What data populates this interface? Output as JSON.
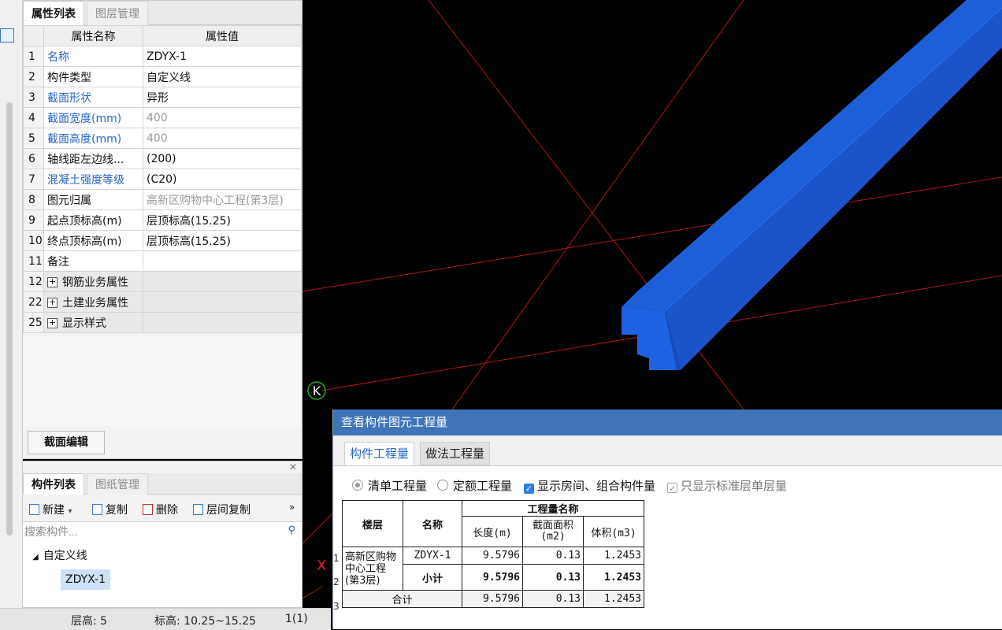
{
  "property_panel": {
    "tabs": [
      "属性列表",
      "图层管理"
    ],
    "headers": {
      "name": "属性名称",
      "value": "属性值"
    },
    "rows": [
      {
        "no": "1",
        "name": "名称",
        "value": "ZDYX-1",
        "name_color": "blue",
        "value_color": "normal"
      },
      {
        "no": "2",
        "name": "构件类型",
        "value": "自定义线",
        "name_color": "normal",
        "value_color": "normal"
      },
      {
        "no": "3",
        "name": "截面形状",
        "value": "异形",
        "name_color": "blue",
        "value_color": "normal"
      },
      {
        "no": "4",
        "name": "截面宽度(mm)",
        "value": "400",
        "name_color": "blue",
        "value_color": "grey"
      },
      {
        "no": "5",
        "name": "截面高度(mm)",
        "value": "400",
        "name_color": "blue",
        "value_color": "grey"
      },
      {
        "no": "6",
        "name": "轴线距左边线...",
        "value": "(200)",
        "name_color": "normal",
        "value_color": "normal"
      },
      {
        "no": "7",
        "name": "混凝土强度等级",
        "value": "(C20)",
        "name_color": "blue",
        "value_color": "normal"
      },
      {
        "no": "8",
        "name": "图元归属",
        "value": "高新区购物中心工程(第3层)",
        "name_color": "normal",
        "value_color": "grey"
      },
      {
        "no": "9",
        "name": "起点顶标高(m)",
        "value": "层顶标高(15.25)",
        "name_color": "normal",
        "value_color": "normal"
      },
      {
        "no": "10",
        "name": "终点顶标高(m)",
        "value": "层顶标高(15.25)",
        "name_color": "normal",
        "value_color": "normal"
      },
      {
        "no": "11",
        "name": "备注",
        "value": "",
        "name_color": "normal",
        "value_color": "normal"
      }
    ],
    "groups": [
      {
        "no": "12",
        "name": "钢筋业务属性"
      },
      {
        "no": "22",
        "name": "土建业务属性"
      },
      {
        "no": "25",
        "name": "显示样式"
      }
    ],
    "section_edit_button": "截面编辑"
  },
  "component_panel": {
    "tabs": [
      "构件列表",
      "图纸管理"
    ],
    "toolbar": {
      "new": "新建",
      "copy": "复制",
      "delete": "删除",
      "floor_copy": "层间复制",
      "more": "»"
    },
    "search_placeholder": "搜索构件...",
    "tree": {
      "category": "自定义线",
      "item": "ZDYX-1"
    }
  },
  "status_bar": {
    "floor_height": "层高:  5",
    "elevation": "标高:  10.25~15.25",
    "page": "1(1)"
  },
  "viewport": {
    "axis_label_k": "K",
    "axis_label_x": "X",
    "beam_color": "#1d5fd9",
    "grid_line_color": "#b01818"
  },
  "dialog": {
    "title": "查看构件图元工程量",
    "tabs": [
      "构件工程量",
      "做法工程量"
    ],
    "options": {
      "list_qty": "清单工程量",
      "quota_qty": "定额工程量",
      "show_rooms": "显示房间、组合构件量",
      "std_floor_only": "只显示标准层单层量"
    },
    "table": {
      "header_group": "工程量名称",
      "col_floor": "楼层",
      "col_name": "名称",
      "col_length": "长度(m)",
      "col_area": "截面面积(m2)",
      "col_volume": "体积(m3)",
      "row_numbers": [
        "1",
        "2",
        "3"
      ],
      "floor": "高新区购物中心工程(第3层)",
      "rows": [
        {
          "name": "ZDYX-1",
          "length": "9.5796",
          "area": "0.13",
          "volume": "1.2453"
        },
        {
          "name": "小计",
          "length": "9.5796",
          "area": "0.13",
          "volume": "1.2453"
        }
      ],
      "total": {
        "name": "合计",
        "length": "9.5796",
        "area": "0.13",
        "volume": "1.2453"
      }
    }
  }
}
